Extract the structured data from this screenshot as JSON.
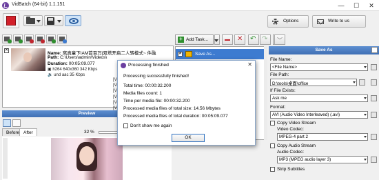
{
  "window": {
    "title": "VidBatch (64-bit) 1.1.151",
    "minimize": "—",
    "maximize": "☐",
    "close": "✕"
  },
  "toolbar": {
    "options_label": "Options",
    "write_label": "Write to us"
  },
  "file": {
    "name_label": "Name:",
    "name_value": "窝真童下IAM首百万|双塔开启二人转模式~ 件融",
    "path_label": "Path:",
    "path_value": "C:\\Users\\admin\\Videos\\",
    "duration_label": "Duration:",
    "duration_value": "00:05:09.077",
    "video_line": "h264 640x360 342 Kbps",
    "audio_line": "und aac 35 Kbps",
    "log_prefixes": [
      "[Vi",
      "[Vi",
      "[Vi",
      "[Vi",
      "[Vi",
      "[Vi"
    ]
  },
  "preview": {
    "title": "Preview",
    "tab_before": "Before",
    "tab_after": "After",
    "zoom_percent": "32 %"
  },
  "tasks": {
    "add_task_label": "Add Task...",
    "items": [
      {
        "label": "Save As..."
      }
    ]
  },
  "saveas": {
    "title": "Save As",
    "file_name_label": "File Name:",
    "file_name_value": "<File Name>",
    "file_path_label": "File Path:",
    "file_path_value": "D:\\tools\\桌面\\office",
    "file_exists_label": "If File Exists:",
    "file_exists_value": "Ask me",
    "format_label": "Format:",
    "format_value": "AVI (Audio Video Interleaved) (.avi)",
    "copy_video_label": "Copy Video Stream",
    "video_codec_label": "Video Codec:",
    "video_codec_value": "MPEG-4 part 2",
    "copy_audio_label": "Copy Audio Stream",
    "audio_codec_label": "Audio Codec:",
    "audio_codec_value": "MP3 (MPEG audio layer 3)",
    "strip_subtitles_label": "Strip Subtitles"
  },
  "dialog": {
    "title": "Processing finished",
    "headline": "Processing successfully finished!",
    "total_time": "Total time: 00:00:32.200",
    "files_count": "Media files count: 1",
    "time_per_file": "Time per media file: 00:00:32.200",
    "total_size": "Processed media files of total size: 14.56 Mbytes",
    "total_duration": "Processed media files of total duration: 00:05:09.077",
    "dont_show": "Don't show me again",
    "ok_label": "OK"
  }
}
